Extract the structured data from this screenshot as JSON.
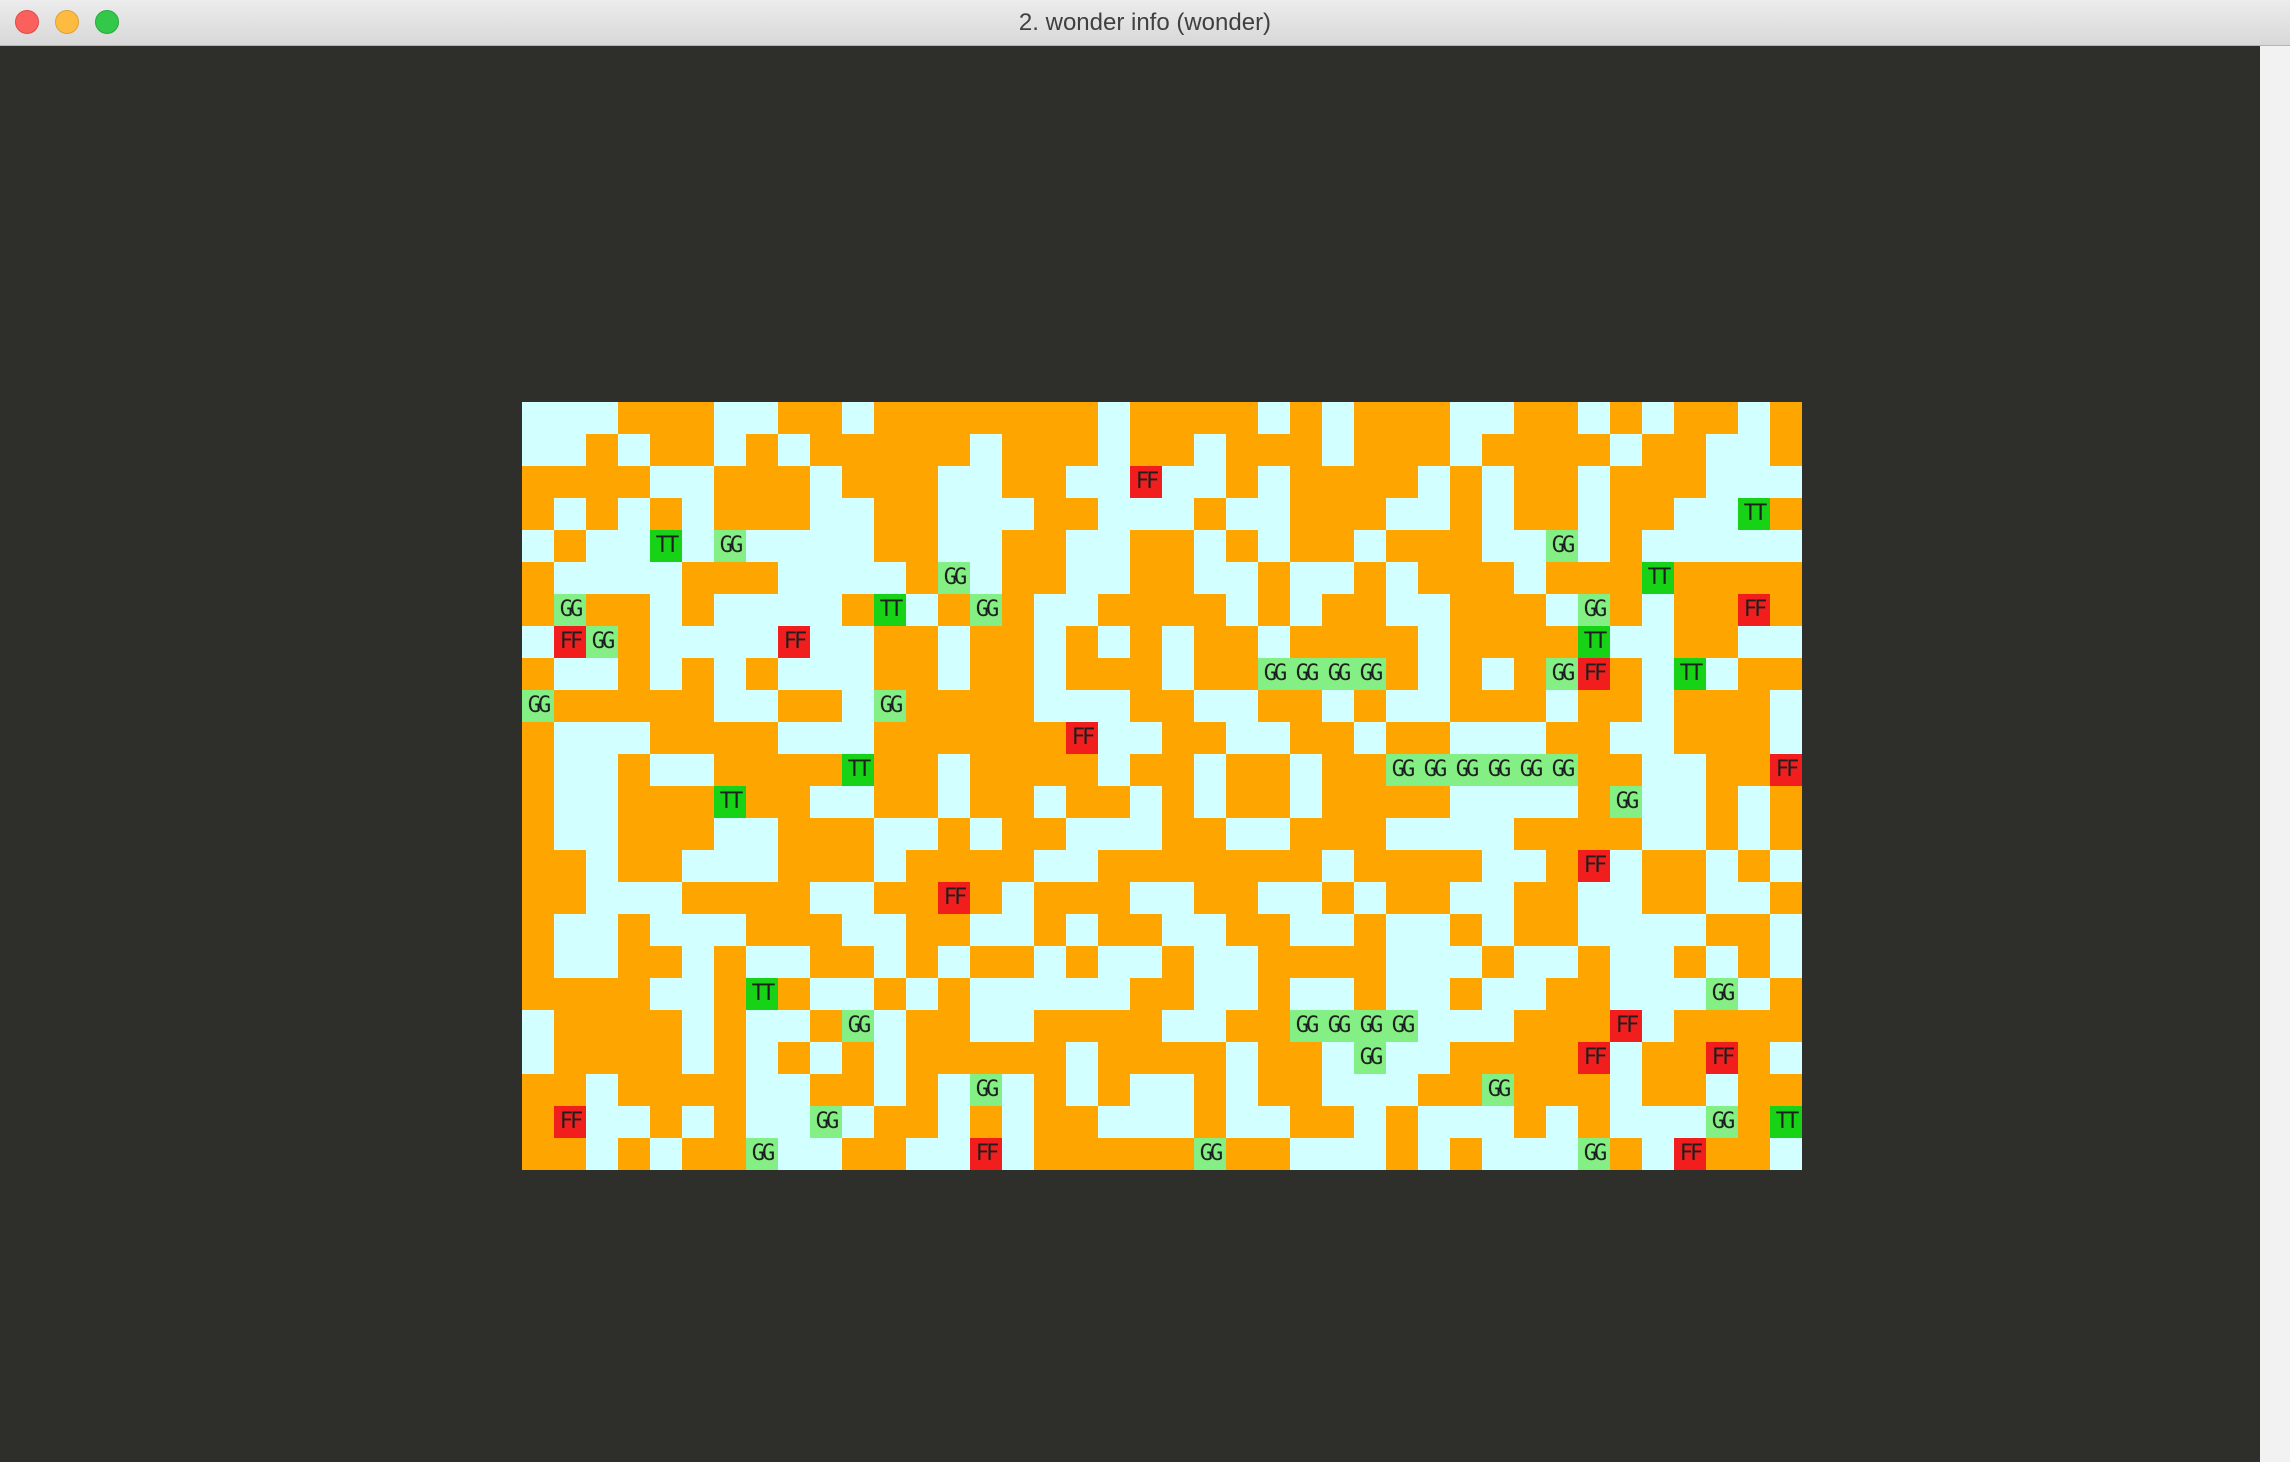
{
  "window": {
    "title": "2. wonder info (wonder)"
  },
  "colors": {
    "viewport_bg": "#2e2e2a",
    "water": "#d2ffff",
    "land": "#ffa500",
    "fire_tile": "#f21d1d",
    "grass_tile": "#84ef84",
    "tree_tile": "#18d218"
  },
  "legend_codes": {
    ".": "water",
    "#": "land",
    "F": "FF tile",
    "G": "GG tile",
    "T": "TT tile"
  },
  "map": {
    "cols": 40,
    "rows": 24,
    "tiles": [
      "...###..##.#######.####.#.###..##.#.##.#",
      "..#.##.#.#####.###.##.###.###.####.##..#",
      "####..###.###..##..F..#.####.#.##.###...",
      "#.#.#.###..##...##...#..###..#.##.##..T#",
      ".#..T.G....##..##..##.#.##.###..G.#.....",
      "#....###....#G.##..##..#..#.###.###T####",
      "#G##.#....#T.#G#..####.#.##..###.G#.##F#",
      ".FG#....F..##.##.#.#.##.####.####T..##..",
      "#..#.#.#...##.##.###.##GGGG#.#.#GF#.T.##",
      "G#####..##.G####...##..##.#..###.##.###.",
      "#...####...######F..##..##.##...##..###.",
      "#..#..####T##.####.##.##.##GGGGGG##..##F",
      "#..###T##..##.##.##.#.##.####....#G..#.#",
      "#..###..###..#.##...##..###....####..#.#",
      "##.##...###.####..#######.####..#F.##.#.",
      "##...####..##F#.###..##..#.##..##..##..#",
      "#..#...###..##..#.##..##..#..#.##....##.",
      "#..##.#..##.#.##.#..#..####...#..#..#.#..",
      "####..#T#..#.#.....##..#..#..#..##...G.#",
      ".####.#..#G.##..####..##GGGG...###F.####",
      ".####.#.#.#.#####.####.##.G..####F.##F#",
      "##.####..##.#.G.#.#..#.##...##G###.##.###",
      "#F..#.#..G.##.#.##...#..##.#...#.#...G#T",
      "##.#.##G..##..F.#####G##...#.#...G#.F##."
    ]
  }
}
